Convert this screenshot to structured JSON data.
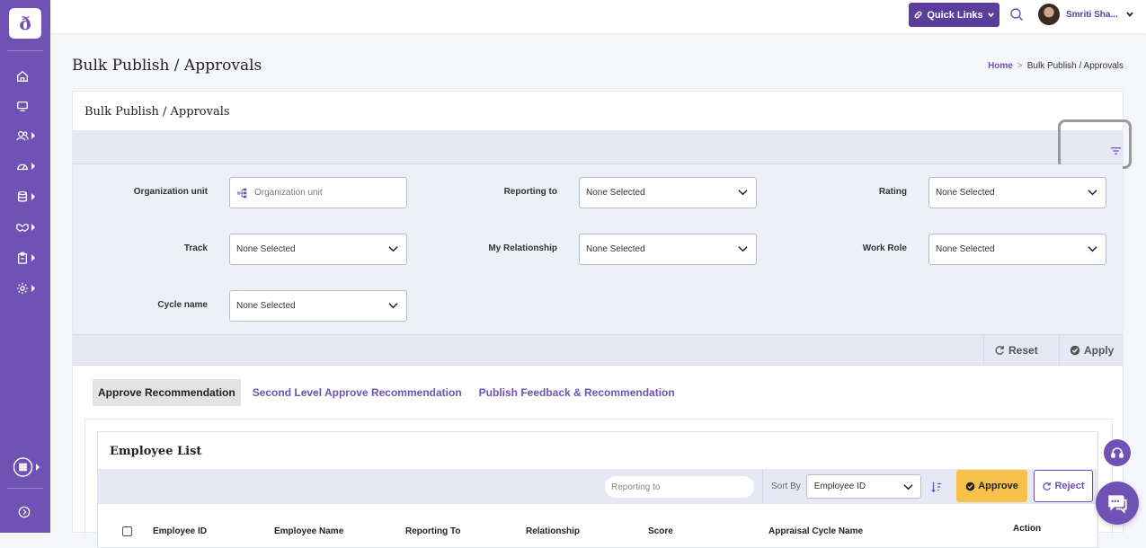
{
  "app": {
    "logo_glyph": "ð",
    "accent": "#6f52b3"
  },
  "sidebar": {
    "items": [
      {
        "icon": "home-icon"
      },
      {
        "icon": "monitor-icon"
      },
      {
        "icon": "users-icon"
      },
      {
        "icon": "dashboard-gauge-icon"
      },
      {
        "icon": "database-icon"
      },
      {
        "icon": "handshake-icon"
      },
      {
        "icon": "clipboard-icon"
      },
      {
        "icon": "settings-gear-icon"
      }
    ],
    "bottom_items": [
      {
        "icon": "apps-grid-icon"
      },
      {
        "icon": "expand-arrow-icon"
      }
    ]
  },
  "topbar": {
    "quick_links": "Quick Links",
    "user_name": "Smriti Sha..."
  },
  "header": {
    "title": "Bulk Publish / Approvals",
    "breadcrumb": {
      "home": "Home",
      "separator": ">",
      "current": "Bulk Publish / Approvals"
    }
  },
  "card": {
    "title": "Bulk Publish / Approvals"
  },
  "filters": {
    "org_unit": {
      "label": "Organization unit",
      "placeholder": "Organization unit"
    },
    "reporting_to": {
      "label": "Reporting to",
      "value": "None Selected"
    },
    "rating": {
      "label": "Rating",
      "value": "None Selected"
    },
    "track": {
      "label": "Track",
      "value": "None Selected"
    },
    "my_relationship": {
      "label": "My Relationship",
      "value": "None Selected"
    },
    "work_role": {
      "label": "Work Role",
      "value": "None Selected"
    },
    "cycle_name": {
      "label": "Cycle name",
      "value": "None Selected"
    }
  },
  "actions": {
    "reset": "Reset",
    "apply": "Apply"
  },
  "tabs": [
    {
      "label": "Approve Recommendation",
      "active": true
    },
    {
      "label": "Second Level Approve Recommendation",
      "active": false
    },
    {
      "label": "Publish Feedback & Recommendation",
      "active": false
    }
  ],
  "employee_list": {
    "title": "Employee List",
    "reporting_placeholder": "Reporting to",
    "sort_by_label": "Sort By",
    "sort_value": "Employee ID",
    "approve": "Approve",
    "reject": "Reject",
    "columns": [
      "Employee ID",
      "Employee Name",
      "Reporting To",
      "Relationship",
      "Score",
      "Appraisal Cycle Name",
      "Action"
    ]
  },
  "colors": {
    "approve": "#f7c24b",
    "sidebar": "#6f52b3",
    "filter_bg": "#eef0f8"
  }
}
